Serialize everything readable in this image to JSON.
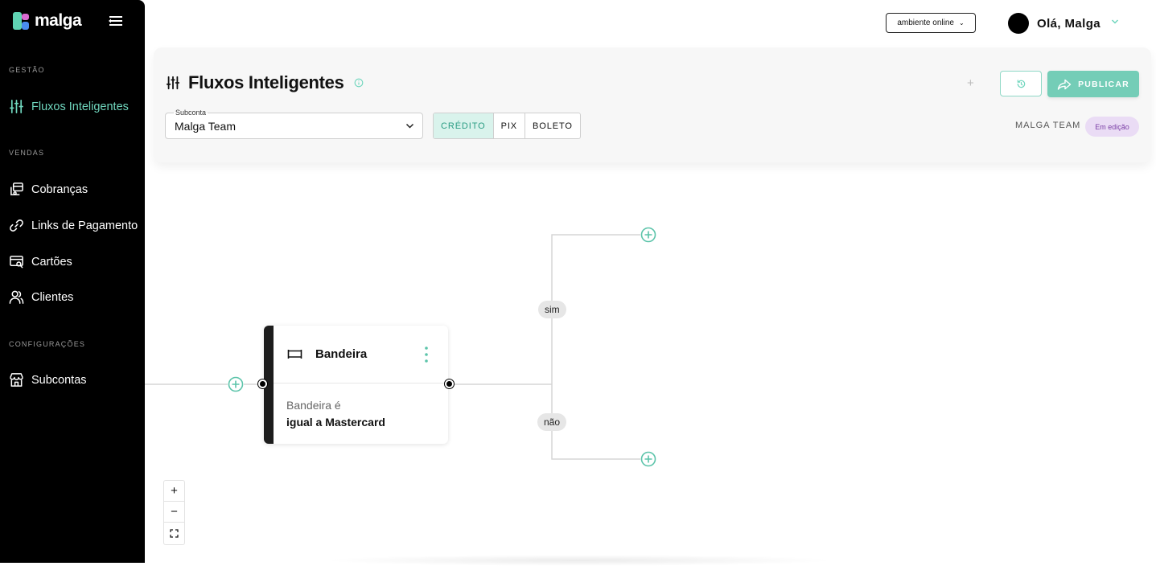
{
  "app": {
    "logo_text": "malga"
  },
  "sidebar": {
    "sections": [
      {
        "label": "GESTÃO"
      },
      {
        "label": "VENDAS"
      },
      {
        "label": "CONFIGURAÇÕES"
      }
    ],
    "items": [
      {
        "label": "Fluxos Inteligentes",
        "icon": "sliders-icon",
        "active": true
      },
      {
        "label": "Cobranças",
        "icon": "charges-icon"
      },
      {
        "label": "Links de Pagamento",
        "icon": "link-icon"
      },
      {
        "label": "Cartões",
        "icon": "card-search-icon"
      },
      {
        "label": "Clientes",
        "icon": "users-icon"
      },
      {
        "label": "Subcontas",
        "icon": "store-icon"
      }
    ]
  },
  "topbar": {
    "environment": "ambiente online",
    "greeting": "Olá, Malga"
  },
  "header": {
    "title": "Fluxos Inteligentes",
    "subconta": {
      "label": "Subconta",
      "value": "Malga Team"
    },
    "payment_tabs": [
      {
        "label": "CRÉDITO",
        "active": true
      },
      {
        "label": "PIX"
      },
      {
        "label": "BOLETO"
      }
    ],
    "plus_label": "+",
    "publish_label": "PUBLICAR",
    "team_name": "MALGA TEAM",
    "status": "Em edição"
  },
  "flow": {
    "node": {
      "title": "Bandeira",
      "condition_prefix": "Bandeira é",
      "condition_value": "igual a Mastercard"
    },
    "branches": {
      "yes": "sim",
      "no": "não"
    }
  },
  "zoom": {
    "in_label": "+",
    "out_label": "−"
  },
  "colors": {
    "accent": "#6fd6bd",
    "publish": "#74cdb7",
    "sidebar_bg": "#000000",
    "status_badge_bg": "#eadcf5",
    "status_badge_text": "#7b3fa6"
  }
}
